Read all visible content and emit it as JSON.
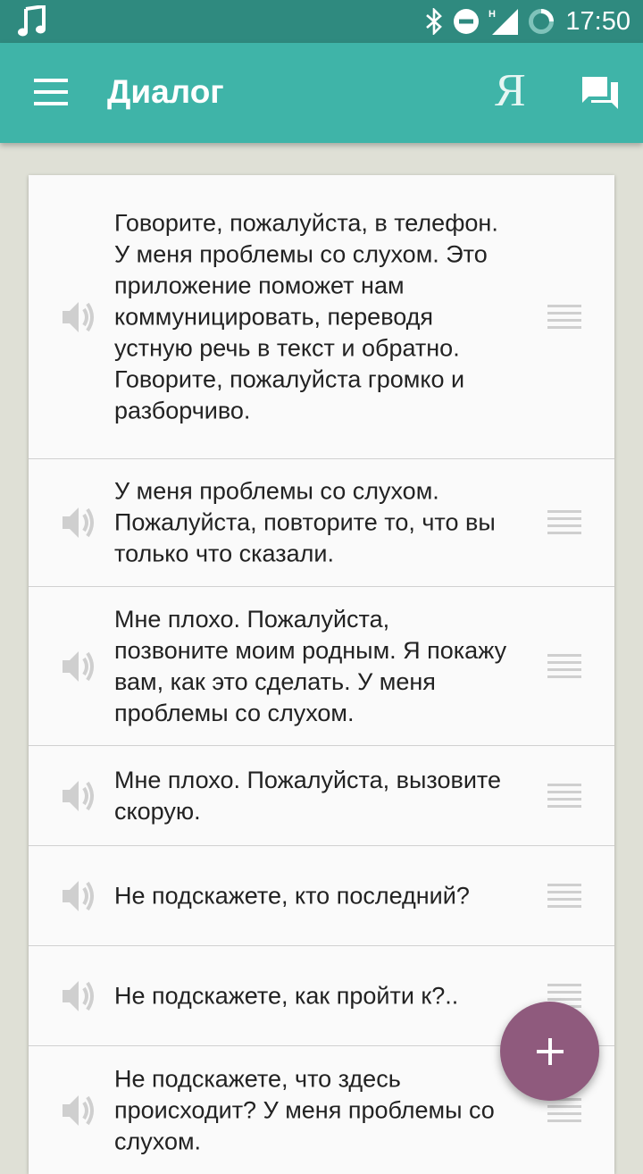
{
  "status_bar": {
    "time": "17:50",
    "icons": [
      "music-note-icon",
      "bluetooth-icon",
      "do-not-disturb-icon",
      "signal-icon",
      "battery-icon"
    ]
  },
  "app_bar": {
    "title": "Диалог",
    "yandex_label": "Я",
    "icons": [
      "menu-icon",
      "chat-icon"
    ]
  },
  "messages": [
    "Говорите, пожалуйста, в телефон. У меня проблемы со слухом. Это приложение поможет нам коммуницировать, переводя устную речь в текст и обратно. Говорите, пожалуйста громко и разборчиво.",
    "У меня проблемы со слухом. Пожалуйста, повторите то, что вы только что сказали.",
    "Мне плохо. Пожалуйста, позвоните моим родным. Я покажу вам, как это сделать. У меня проблемы со слухом.",
    "Мне плохо. Пожалуйста, вызовите скорую.",
    "Не подскажете, кто последний?",
    "Не подскажете, как пройти к?..",
    "Не подскажете, что здесь происходит? У меня проблемы со слухом."
  ],
  "colors": {
    "status_bar": "#2f8a7f",
    "app_bar": "#3fb4a8",
    "fab": "#8f5a7d",
    "background": "#dfe0d6"
  }
}
